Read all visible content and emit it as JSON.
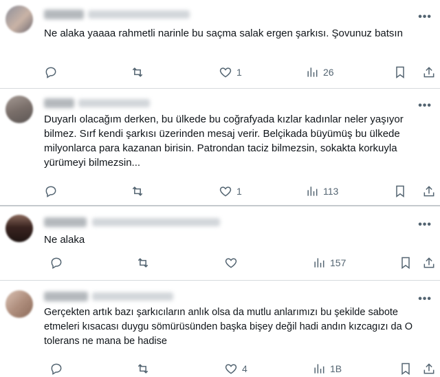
{
  "more_glyph": "•••",
  "tweets": [
    {
      "text": "Ne alaka yaaaa rahmetli narinle bu saçma salak ergen şarkısı. Şovunuz batsın",
      "replies": "",
      "retweets": "",
      "likes": "1",
      "views": "26",
      "avatar_colors": [
        "#8d8f9a",
        "#c9b3a6",
        "#6f6a72"
      ]
    },
    {
      "text": "Duyarlı olacağım derken, bu ülkede bu coğrafyada kızlar kadınlar neler yaşıyor bilmez. Sırf kendi şarkısı üzerinden mesaj verir. Belçikada büyümüş bu ülkede milyonlarca para kazanan birisin. Patrondan taciz bilmezsin, sokakta korkuyla yürümeyi bilmezsin...",
      "replies": "",
      "retweets": "",
      "likes": "1",
      "views": "113",
      "avatar_colors": [
        "#7a6f6a",
        "#a59a94",
        "#5c5654"
      ]
    },
    {
      "text": "Ne alaka",
      "replies": "",
      "retweets": "",
      "likes": "",
      "views": "157",
      "avatar_colors": [
        "#3a2420",
        "#8a6a5c",
        "#1e1412"
      ]
    },
    {
      "text": "Gerçekten artık bazı şarkıcıların  anlık olsa da mutlu anlarımızı bu şekilde sabote etmeleri kısacası duygu sömürüsünden başka bişey değil hadi andın kızcagızı da O tolerans ne mana be hadise",
      "replies": "",
      "retweets": "",
      "likes": "4",
      "views": "1B",
      "avatar_colors": [
        "#b08f7e",
        "#d9c2b4",
        "#8c6b5a"
      ]
    }
  ]
}
